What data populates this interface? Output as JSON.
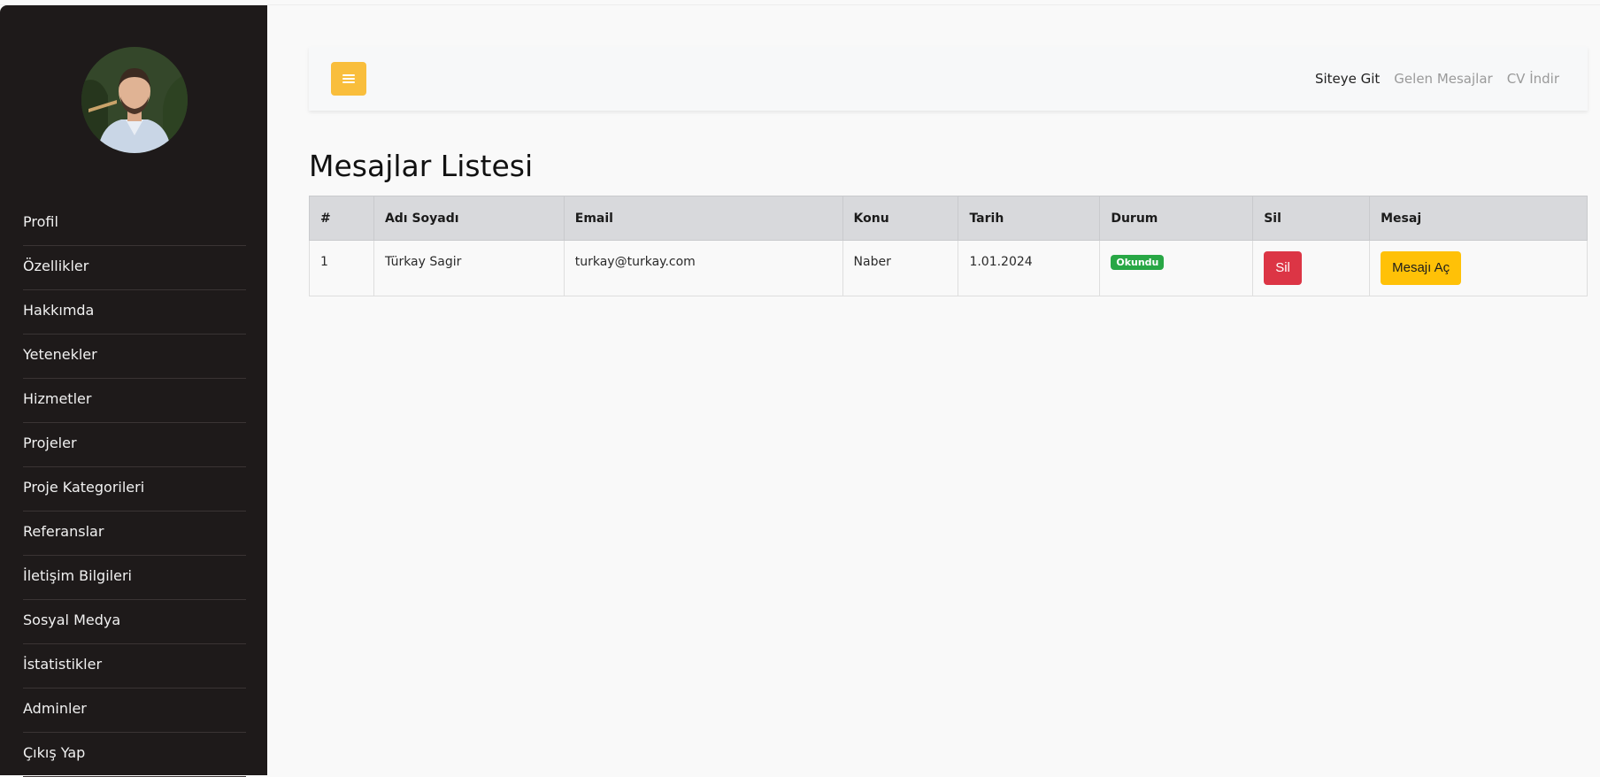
{
  "sidebar": {
    "avatar_icon": "avatar",
    "items": [
      {
        "label": "Profil"
      },
      {
        "label": "Özellikler"
      },
      {
        "label": "Hakkımda"
      },
      {
        "label": "Yetenekler"
      },
      {
        "label": "Hizmetler"
      },
      {
        "label": "Projeler"
      },
      {
        "label": "Proje Kategorileri"
      },
      {
        "label": "Referanslar"
      },
      {
        "label": "İletişim Bilgileri"
      },
      {
        "label": "Sosyal Medya"
      },
      {
        "label": "İstatistikler"
      },
      {
        "label": "Adminler"
      },
      {
        "label": "Çıkış Yap"
      }
    ]
  },
  "topbar": {
    "menu_icon": "hamburger-menu-icon",
    "links": [
      {
        "label": "Siteye Git"
      },
      {
        "label": "Gelen Mesajlar"
      },
      {
        "label": "CV İndir"
      }
    ]
  },
  "main": {
    "title": "Mesajlar Listesi",
    "table": {
      "headers": [
        "#",
        "Adı Soyadı",
        "Email",
        "Konu",
        "Tarih",
        "Durum",
        "Sil",
        "Mesaj"
      ],
      "rows": [
        {
          "index": "1",
          "name": "Türkay Sagir",
          "email": "turkay@turkay.com",
          "subject": "Naber",
          "date": "1.01.2024",
          "status": "Okundu",
          "delete_label": "Sil",
          "open_label": "Mesajı Aç"
        }
      ]
    }
  },
  "colors": {
    "sidebar_bg": "#1e1a1a",
    "accent": "#f9be3c",
    "danger": "#dc3545",
    "success": "#28a745",
    "warning": "#ffc107"
  }
}
